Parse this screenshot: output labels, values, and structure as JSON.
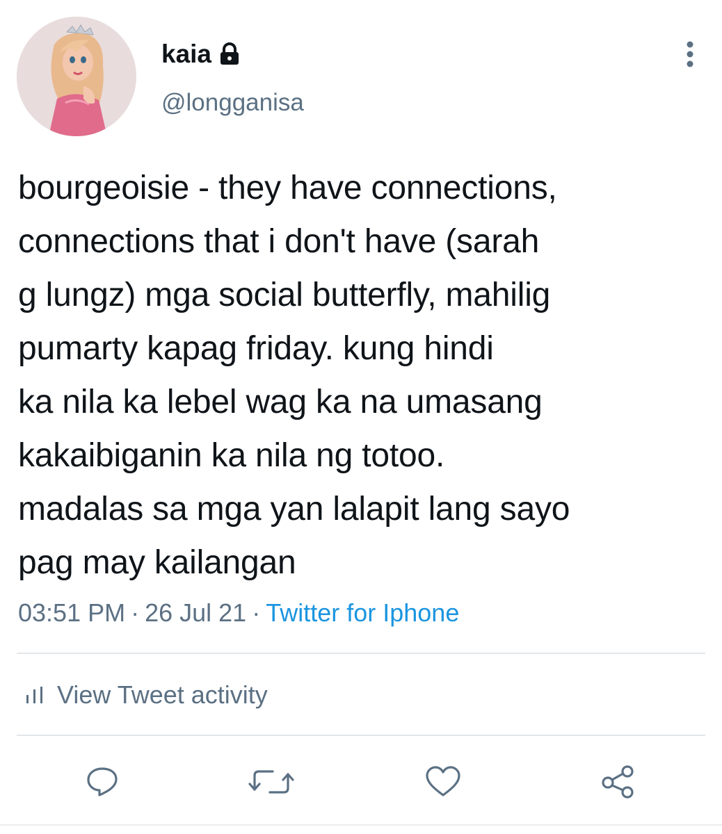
{
  "user": {
    "display_name": "kaia",
    "handle": "@longganisa",
    "protected_icon": "lock-icon",
    "avatar": "avatar-image"
  },
  "tweet": {
    "text": "bourgeoisie - they have connections,\nconnections that i don't have (sarah\ng lungz) mga social butterfly, mahilig\npumarty kapag friday. kung hindi\nka nila ka lebel wag ka na umasang\nkakaibiganin ka nila ng totoo.\nmadalas sa mga yan lalapit lang sayo\npag may kailangan",
    "time": "03:51 PM",
    "separator": "·",
    "date": "26 Jul 21",
    "source": "Twitter for Iphone"
  },
  "activity": {
    "label": "View Tweet activity",
    "icon": "bar-chart-icon"
  },
  "actions": {
    "reply_icon": "reply-icon",
    "retweet_icon": "retweet-icon",
    "like_icon": "heart-icon",
    "share_icon": "share-icon",
    "more_icon": "more-vertical-icon"
  },
  "colors": {
    "text": "#0f1419",
    "secondary": "#5b7083",
    "link": "#1b95e0",
    "divider": "#e3e6e8"
  }
}
